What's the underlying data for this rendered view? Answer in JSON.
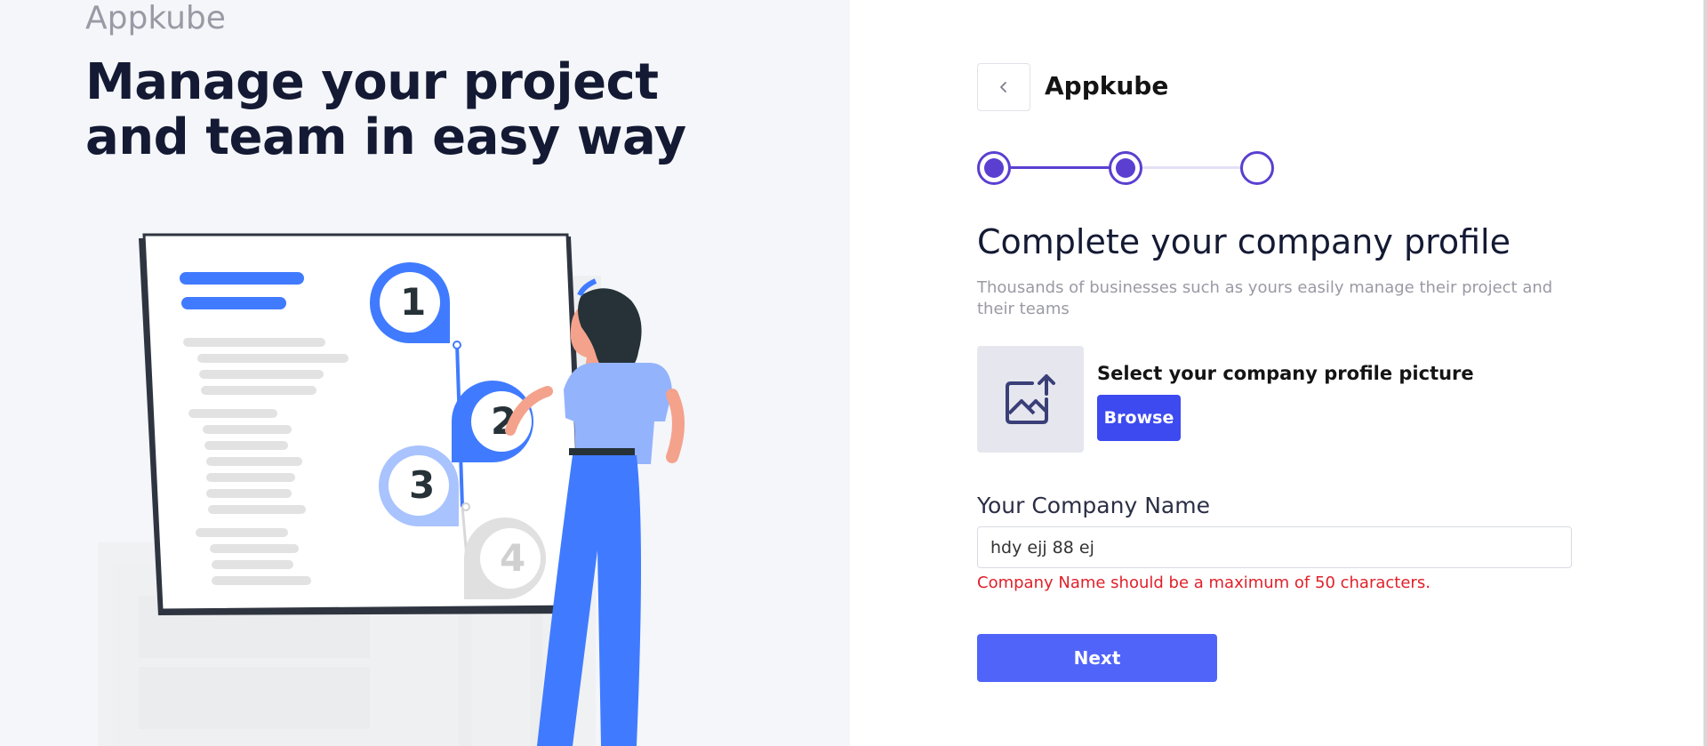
{
  "hero": {
    "brand": "Appkube",
    "headline": "Manage your project and team in easy way",
    "illustration": {
      "step_numbers": [
        "1",
        "2",
        "3",
        "4"
      ]
    }
  },
  "header": {
    "back_icon": "chevron-left-icon",
    "brand": "Appkube"
  },
  "stepper": {
    "total": 3,
    "completed": 2,
    "color": "#5a3fd1"
  },
  "form": {
    "title": "Complete your company profile",
    "subtitle": "Thousands of businesses such as yours easily manage their project and their teams",
    "profile_picture": {
      "icon": "image-upload-icon",
      "label": "Select your company profile picture",
      "browse_label": "Browse"
    },
    "company_name": {
      "label": "Your Company Name",
      "value": "hdy ejj 88 ej",
      "error": "Company Name should be a maximum of 50 characters."
    },
    "next_label": "Next"
  },
  "colors": {
    "primary": "#3d4af0",
    "next": "#5064fa",
    "error": "#e0202a",
    "accent_blue": "#407bff"
  }
}
